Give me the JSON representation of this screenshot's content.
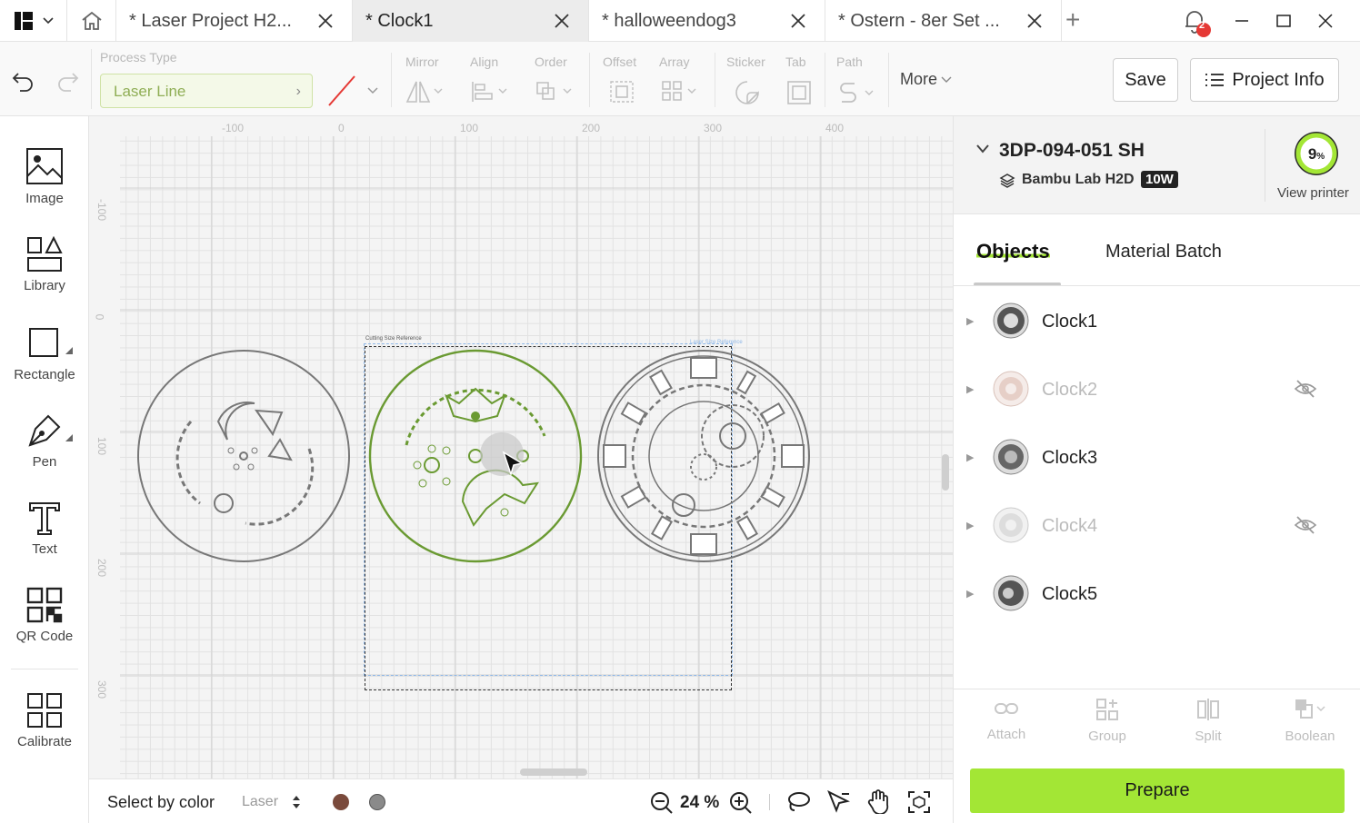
{
  "tabs": [
    {
      "label": "* Laser Project H2..."
    },
    {
      "label": "* Clock1"
    },
    {
      "label": "* halloweendog3"
    },
    {
      "label": "* Ostern - 8er Set ..."
    }
  ],
  "notifications": {
    "count": "2"
  },
  "toolbar": {
    "process_type_label": "Process Type",
    "process_value": "Laser Line",
    "mirror": "Mirror",
    "align": "Align",
    "order": "Order",
    "offset": "Offset",
    "array": "Array",
    "sticker": "Sticker",
    "tab": "Tab",
    "path": "Path",
    "more": "More",
    "save": "Save",
    "project_info": "Project Info"
  },
  "sidebar": {
    "items": [
      {
        "label": "Image",
        "icon": "image-icon"
      },
      {
        "label": "Library",
        "icon": "library-icon"
      },
      {
        "label": "Rectangle",
        "icon": "rectangle-icon"
      },
      {
        "label": "Pen",
        "icon": "pen-icon"
      },
      {
        "label": "Text",
        "icon": "text-icon"
      },
      {
        "label": "QR Code",
        "icon": "qr-code-icon"
      },
      {
        "label": "Calibrate",
        "icon": "calibrate-icon"
      }
    ]
  },
  "canvas": {
    "ruler_top": [
      "-100",
      "0",
      "100",
      "200",
      "300",
      "400"
    ],
    "ruler_left": [
      "-100",
      "0",
      "100",
      "200",
      "300"
    ],
    "cutting_ref": "Cutting Size Reference",
    "laser_ref": "Laser Size Reference"
  },
  "bottombar": {
    "select_by_color": "Select by color",
    "mode": "Laser",
    "zoom": "24 %",
    "color1": "#7a4a3c",
    "color2": "#8a8a8a"
  },
  "printer": {
    "name": "3DP-094-051 SH",
    "model": "Bambu Lab H2D",
    "power": "10W",
    "progress_percent": 9,
    "progress_text": "9",
    "progress_unit": "%",
    "view_printer": "View printer"
  },
  "panel_tabs": {
    "objects": "Objects",
    "material_batch": "Material Batch"
  },
  "objects": [
    {
      "name": "Clock1",
      "hidden": false
    },
    {
      "name": "Clock2",
      "hidden": true
    },
    {
      "name": "Clock3",
      "hidden": false
    },
    {
      "name": "Clock4",
      "hidden": true
    },
    {
      "name": "Clock5",
      "hidden": false
    }
  ],
  "actions": {
    "attach": "Attach",
    "group": "Group",
    "split": "Split",
    "boolean": "Boolean"
  },
  "prepare": "Prepare",
  "colors": {
    "accent": "#a3e635",
    "selection_green": "#6a9a32"
  }
}
